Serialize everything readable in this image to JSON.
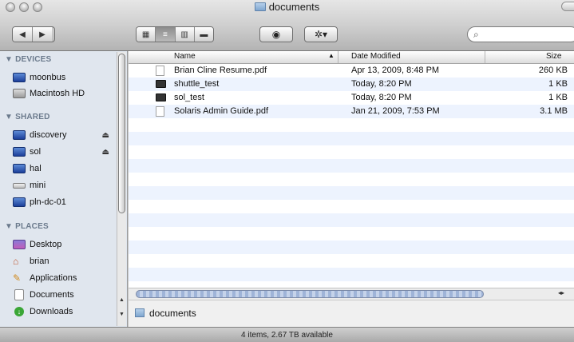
{
  "window": {
    "title": "documents"
  },
  "toolbar": {
    "back_icon": "back-arrow-icon",
    "forward_icon": "forward-arrow-icon",
    "view_modes": [
      "icon-view",
      "list-view",
      "column-view",
      "coverflow-view"
    ],
    "active_view": "list-view",
    "quicklook_icon": "eye-icon",
    "action_icon": "gear-icon",
    "search_value": ""
  },
  "sidebar": {
    "sections": [
      {
        "title": "▼ DEVICES",
        "items": [
          {
            "label": "moonbus",
            "icon": "mac-display-icon"
          },
          {
            "label": "Macintosh HD",
            "icon": "hard-drive-icon"
          }
        ]
      },
      {
        "title": "▼ SHARED",
        "items": [
          {
            "label": "discovery",
            "icon": "network-computer-icon",
            "eject": true
          },
          {
            "label": "sol",
            "icon": "network-computer-icon",
            "eject": true
          },
          {
            "label": "hal",
            "icon": "network-computer-icon"
          },
          {
            "label": "mini",
            "icon": "mac-mini-icon"
          },
          {
            "label": "pln-dc-01",
            "icon": "network-computer-icon"
          }
        ]
      },
      {
        "title": "▼ PLACES",
        "items": [
          {
            "label": "Desktop",
            "icon": "desktop-icon"
          },
          {
            "label": "brian",
            "icon": "home-icon"
          },
          {
            "label": "Applications",
            "icon": "applications-icon"
          },
          {
            "label": "Documents",
            "icon": "documents-icon"
          },
          {
            "label": "Downloads",
            "icon": "downloads-icon"
          }
        ]
      }
    ]
  },
  "file_list": {
    "columns": {
      "name": "Name",
      "date": "Date Modified",
      "size": "Size"
    },
    "rows": [
      {
        "name": "Brian Cline Resume.pdf",
        "date": "Apr 13, 2009, 8:48 PM",
        "size": "260 KB",
        "icon": "pdf-document-icon"
      },
      {
        "name": "shuttle_test",
        "date": "Today, 8:20 PM",
        "size": "1 KB",
        "icon": "executable-icon"
      },
      {
        "name": "sol_test",
        "date": "Today, 8:20 PM",
        "size": "1 KB",
        "icon": "executable-icon"
      },
      {
        "name": "Solaris Admin Guide.pdf",
        "date": "Jan 21, 2009, 7:53 PM",
        "size": "3.1 MB",
        "icon": "pdf-document-icon"
      }
    ]
  },
  "path_bar": {
    "label": "documents"
  },
  "status_bar": {
    "text": "4 items, 2.67 TB available"
  }
}
